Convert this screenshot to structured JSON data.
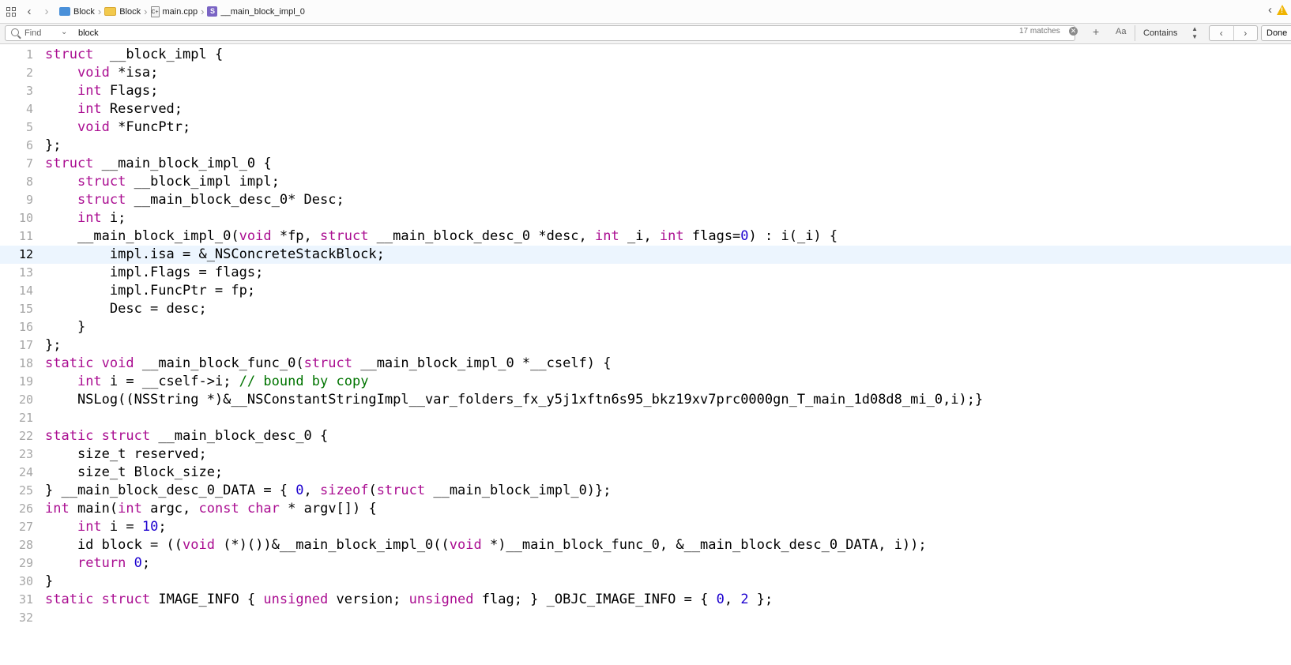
{
  "jumpbar": {
    "crumbs": [
      {
        "label": "Block",
        "icon": "project-icon"
      },
      {
        "label": "Block",
        "icon": "folder-icon"
      },
      {
        "label": "main.cpp",
        "icon": "cpp-file-icon"
      },
      {
        "label": "__main_block_impl_0",
        "icon": "struct-symbol-icon",
        "badge": "S"
      }
    ],
    "cpp_badge": "C+",
    "warning_mark": "!"
  },
  "findbar": {
    "mode": "Find",
    "query": "block",
    "matches": "17 matches",
    "case_label": "Aa",
    "match_style": "Contains",
    "done": "Done"
  },
  "editor": {
    "current_line": 12,
    "colors": {
      "keyword": "#aa0d91",
      "number": "#1c00cf",
      "comment": "#007400",
      "highlight": "#ecf5fe"
    },
    "lines": [
      {
        "n": "1",
        "tokens": [
          [
            "kw",
            "struct"
          ],
          [
            "",
            "  __block_impl {"
          ]
        ]
      },
      {
        "n": "2",
        "tokens": [
          [
            "",
            "    "
          ],
          [
            "kw",
            "void"
          ],
          [
            "",
            " *isa;"
          ]
        ]
      },
      {
        "n": "3",
        "tokens": [
          [
            "",
            "    "
          ],
          [
            "kw",
            "int"
          ],
          [
            "",
            " Flags;"
          ]
        ]
      },
      {
        "n": "4",
        "tokens": [
          [
            "",
            "    "
          ],
          [
            "kw",
            "int"
          ],
          [
            "",
            " Reserved;"
          ]
        ]
      },
      {
        "n": "5",
        "tokens": [
          [
            "",
            "    "
          ],
          [
            "kw",
            "void"
          ],
          [
            "",
            " *FuncPtr;"
          ]
        ]
      },
      {
        "n": "6",
        "tokens": [
          [
            "",
            "};"
          ]
        ]
      },
      {
        "n": "7",
        "tokens": [
          [
            "kw",
            "struct"
          ],
          [
            "",
            " __main_block_impl_0 {"
          ]
        ]
      },
      {
        "n": "8",
        "tokens": [
          [
            "",
            "    "
          ],
          [
            "kw",
            "struct"
          ],
          [
            "",
            " __block_impl impl;"
          ]
        ]
      },
      {
        "n": "9",
        "tokens": [
          [
            "",
            "    "
          ],
          [
            "kw",
            "struct"
          ],
          [
            "",
            " __main_block_desc_0* Desc;"
          ]
        ]
      },
      {
        "n": "10",
        "tokens": [
          [
            "",
            "    "
          ],
          [
            "kw",
            "int"
          ],
          [
            "",
            " i;"
          ]
        ]
      },
      {
        "n": "11",
        "tokens": [
          [
            "",
            "    __main_block_impl_0("
          ],
          [
            "kw",
            "void"
          ],
          [
            "",
            " *fp, "
          ],
          [
            "kw",
            "struct"
          ],
          [
            "",
            " __main_block_desc_0 *desc, "
          ],
          [
            "kw",
            "int"
          ],
          [
            "",
            " _i, "
          ],
          [
            "kw",
            "int"
          ],
          [
            "",
            " flags="
          ],
          [
            "num",
            "0"
          ],
          [
            "",
            ") : i(_i) {"
          ]
        ]
      },
      {
        "n": "12",
        "tokens": [
          [
            "",
            "        impl.isa = &_NSConcreteStackBlock;"
          ]
        ]
      },
      {
        "n": "13",
        "tokens": [
          [
            "",
            "        impl.Flags = flags;"
          ]
        ]
      },
      {
        "n": "14",
        "tokens": [
          [
            "",
            "        impl.FuncPtr = fp;"
          ]
        ]
      },
      {
        "n": "15",
        "tokens": [
          [
            "",
            "        Desc = desc;"
          ]
        ]
      },
      {
        "n": "16",
        "tokens": [
          [
            "",
            "    }"
          ]
        ]
      },
      {
        "n": "17",
        "tokens": [
          [
            "",
            "};"
          ]
        ]
      },
      {
        "n": "18",
        "tokens": [
          [
            "kw",
            "static"
          ],
          [
            "",
            " "
          ],
          [
            "kw",
            "void"
          ],
          [
            "",
            " __main_block_func_0("
          ],
          [
            "kw",
            "struct"
          ],
          [
            "",
            " __main_block_impl_0 *__cself) {"
          ]
        ]
      },
      {
        "n": "19",
        "tokens": [
          [
            "",
            "    "
          ],
          [
            "kw",
            "int"
          ],
          [
            "",
            " i = __cself->i; "
          ],
          [
            "cm",
            "// bound by copy"
          ]
        ]
      },
      {
        "n": "20",
        "tokens": [
          [
            "",
            "    NSLog((NSString *)&__NSConstantStringImpl__var_folders_fx_y5j1xftn6s95_bkz19xv7prc0000gn_T_main_1d08d8_mi_0,i);}"
          ]
        ]
      },
      {
        "n": "21",
        "tokens": [
          [
            "",
            ""
          ]
        ]
      },
      {
        "n": "22",
        "tokens": [
          [
            "kw",
            "static"
          ],
          [
            "",
            " "
          ],
          [
            "kw",
            "struct"
          ],
          [
            "",
            " __main_block_desc_0 {"
          ]
        ]
      },
      {
        "n": "23",
        "tokens": [
          [
            "",
            "    size_t reserved;"
          ]
        ]
      },
      {
        "n": "24",
        "tokens": [
          [
            "",
            "    size_t Block_size;"
          ]
        ]
      },
      {
        "n": "25",
        "tokens": [
          [
            "",
            "} __main_block_desc_0_DATA = { "
          ],
          [
            "num",
            "0"
          ],
          [
            "",
            ", "
          ],
          [
            "kw",
            "sizeof"
          ],
          [
            "",
            "("
          ],
          [
            "kw",
            "struct"
          ],
          [
            "",
            " __main_block_impl_0)};"
          ]
        ]
      },
      {
        "n": "26",
        "tokens": [
          [
            "kw",
            "int"
          ],
          [
            "",
            " main("
          ],
          [
            "kw",
            "int"
          ],
          [
            "",
            " argc, "
          ],
          [
            "kw",
            "const"
          ],
          [
            "",
            " "
          ],
          [
            "kw",
            "char"
          ],
          [
            "",
            " * argv[]) {"
          ]
        ]
      },
      {
        "n": "27",
        "tokens": [
          [
            "",
            "    "
          ],
          [
            "kw",
            "int"
          ],
          [
            "",
            " i = "
          ],
          [
            "num",
            "10"
          ],
          [
            "",
            ";"
          ]
        ]
      },
      {
        "n": "28",
        "tokens": [
          [
            "",
            "    id block = (("
          ],
          [
            "kw",
            "void"
          ],
          [
            "",
            " (*)())&__main_block_impl_0(("
          ],
          [
            "kw",
            "void"
          ],
          [
            "",
            " *)__main_block_func_0, &__main_block_desc_0_DATA, i));"
          ]
        ]
      },
      {
        "n": "29",
        "tokens": [
          [
            "",
            "    "
          ],
          [
            "kw",
            "return"
          ],
          [
            "",
            " "
          ],
          [
            "num",
            "0"
          ],
          [
            "",
            ";"
          ]
        ]
      },
      {
        "n": "30",
        "tokens": [
          [
            "",
            "}"
          ]
        ]
      },
      {
        "n": "31",
        "tokens": [
          [
            "kw",
            "static"
          ],
          [
            "",
            " "
          ],
          [
            "kw",
            "struct"
          ],
          [
            "",
            " IMAGE_INFO { "
          ],
          [
            "kw",
            "unsigned"
          ],
          [
            "",
            " version; "
          ],
          [
            "kw",
            "unsigned"
          ],
          [
            "",
            " flag; } _OBJC_IMAGE_INFO = { "
          ],
          [
            "num",
            "0"
          ],
          [
            "",
            ", "
          ],
          [
            "num",
            "2"
          ],
          [
            "",
            " };"
          ]
        ]
      },
      {
        "n": "32",
        "tokens": [
          [
            "",
            ""
          ]
        ]
      }
    ]
  }
}
